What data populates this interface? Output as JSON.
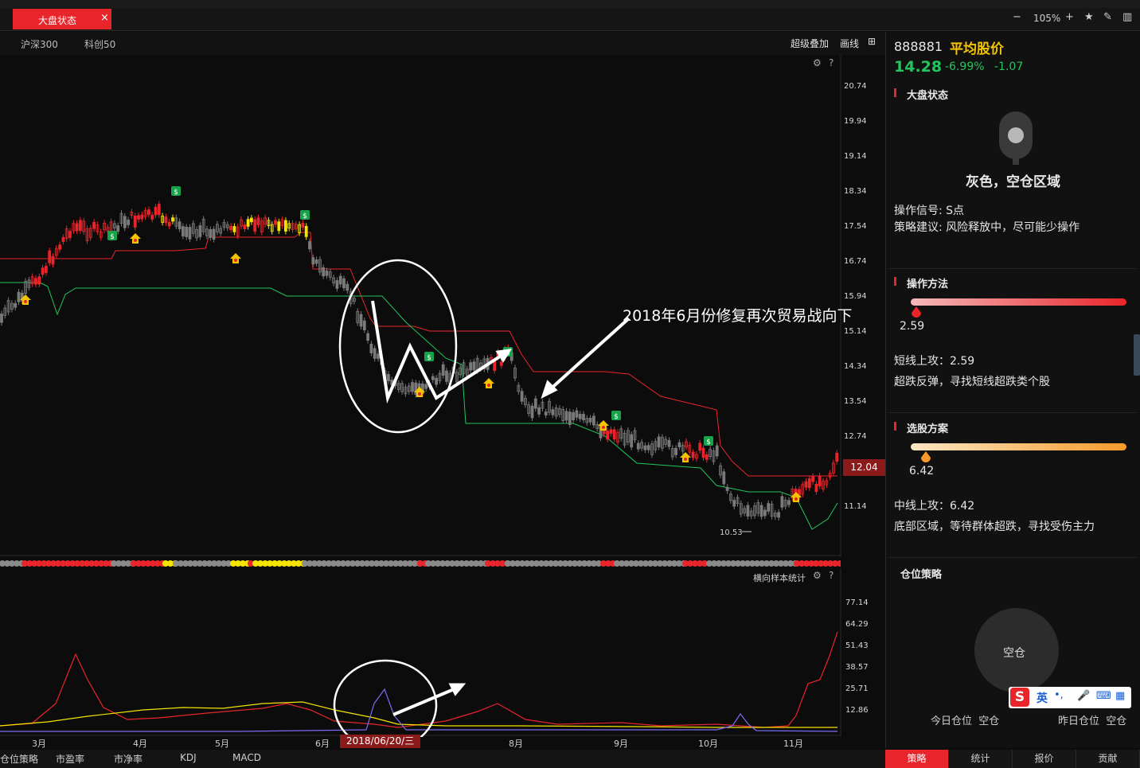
{
  "tab": {
    "title": "大盘状态",
    "close": "×"
  },
  "toolbar": {
    "zoom": "105%",
    "zoom_out": "−",
    "zoom_in": "+"
  },
  "index_tabs": [
    "沪深300",
    "科创50"
  ],
  "chart_tools": {
    "overlay": "超级叠加",
    "draw": "画线"
  },
  "main_axis": {
    "y_ticks": [
      "20.74",
      "19.94",
      "19.14",
      "18.34",
      "17.54",
      "16.74",
      "15.94",
      "15.14",
      "14.34",
      "13.54",
      "12.74",
      "11.14"
    ],
    "current_price": "12.04",
    "min_label": "10.53"
  },
  "annotation": {
    "text": "2018年6月份修复再次贸易战向下"
  },
  "sub_chart": {
    "title": "横向样本统计",
    "y_ticks": [
      "77.14",
      "64.29",
      "51.43",
      "38.57",
      "25.71",
      "12.86"
    ]
  },
  "x_axis": {
    "months": [
      "3月",
      "4月",
      "5月",
      "6月",
      "8月",
      "9月",
      "10月",
      "11月"
    ],
    "cursor_date": "2018/06/20/三"
  },
  "bottom_tabs": [
    "仓位策略",
    "市盈率",
    "市净率",
    "KDJ",
    "MACD"
  ],
  "stock": {
    "code": "888881",
    "name": "平均股价",
    "price": "14.28",
    "change_pct": "-6.99%",
    "change": "-1.07"
  },
  "market_state": {
    "title": "大盘状态",
    "status": "灰色，空仓区域",
    "signal": "操作信号: S点",
    "advice": "策略建议: 风险释放中，尽可能少操作"
  },
  "method": {
    "title": "操作方法",
    "value_label": "2.59",
    "value": 2.59,
    "line1": "短线上攻：2.59",
    "line2": "超跌反弹，寻找短线超跌类个股"
  },
  "selection": {
    "title": "选股方案",
    "value_label": "6.42",
    "value": 6.42,
    "line1": "中线上攻：6.42",
    "line2": "底部区域，等待群体超跌，寻找受伤主力"
  },
  "position": {
    "title": "仓位策略",
    "center": "空仓",
    "today": "今日仓位  空仓",
    "yesterday": "昨日仓位  空仓"
  },
  "ime": {
    "lang": "英",
    "punct": "•,"
  },
  "right_tabs": [
    "策略",
    "统计",
    "报价",
    "贡献"
  ],
  "colors": {
    "red": "#e8252a",
    "green": "#22c55e",
    "yellow": "#f5e400",
    "gold": "#f5c400"
  }
}
